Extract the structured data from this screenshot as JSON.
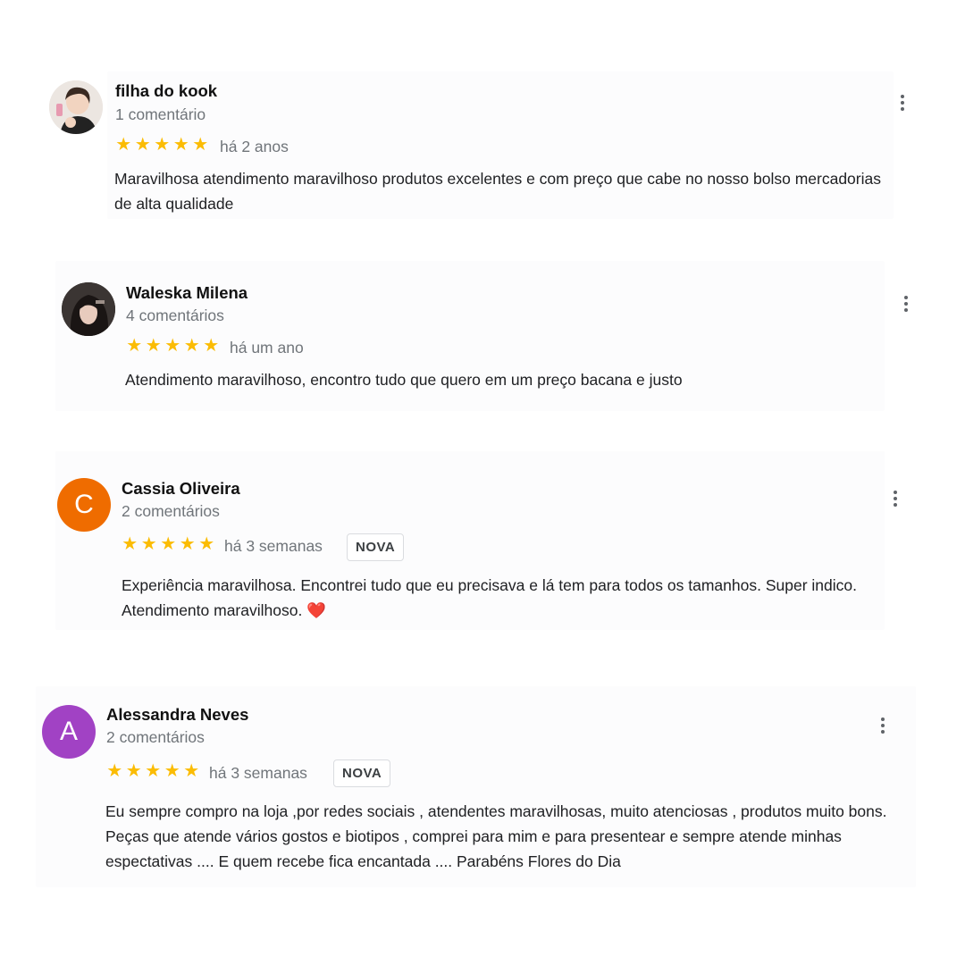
{
  "reviews": [
    {
      "name": "filha do kook",
      "count": "1 comentário",
      "rating": 5,
      "date": "há 2 anos",
      "badge": "",
      "text": "Maravilhosa atendimento maravilhoso produtos excelentes e com preço que cabe no nosso bolso mercadorias de alta qualidade",
      "avatar": "photo"
    },
    {
      "name": "Waleska Milena",
      "count": "4 comentários",
      "rating": 5,
      "date": "há um ano",
      "badge": "",
      "text": "Atendimento maravilhoso, encontro tudo que quero em um preço bacana e justo",
      "avatar": "photo"
    },
    {
      "name": "Cassia Oliveira",
      "count": "2 comentários",
      "rating": 5,
      "date": "há 3 semanas",
      "badge": "NOVA",
      "text": "Experiência maravilhosa. Encontrei tudo que eu precisava e lá tem para todos os tamanhos. Super indico. Atendimento maravilhoso. ❤️",
      "avatar": "C",
      "avatar_color": "#ef6c00"
    },
    {
      "name": "Alessandra Neves",
      "count": "2 comentários",
      "rating": 5,
      "date": "há 3 semanas",
      "badge": "NOVA",
      "text": "Eu sempre compro na loja ,por redes sociais ,  atendentes maravilhosas, muito atenciosas , produtos muito bons. Peças que atende vários gostos e biotipos , comprei para mim e para presentear e sempre atende minhas espectativas  .... E quem recebe fica encantada .... Parabéns Flores do Dia",
      "avatar": "A",
      "avatar_color": "#a142c4"
    }
  ],
  "icons": {
    "star": "★",
    "more": "more-vert-icon"
  },
  "colors": {
    "star": "#fbbc04",
    "secondary_text": "#70757a"
  }
}
